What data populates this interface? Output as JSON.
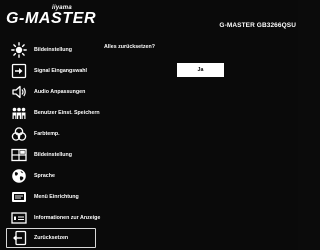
{
  "header": {
    "brand_small": "iiyama",
    "brand_main": "G-MASTER",
    "model": "G-MASTER GB3266QSU"
  },
  "sidebar": {
    "items": [
      {
        "label": "Bildeinstellung",
        "icon": "brightness-icon"
      },
      {
        "label": "Signal Eingangswahl",
        "icon": "input-select-icon"
      },
      {
        "label": "Audio Anpassungen",
        "icon": "speaker-icon"
      },
      {
        "label": "Benutzer Einst. Speichern",
        "icon": "users-icon"
      },
      {
        "label": "Farbtemp.",
        "icon": "color-temperature-icon"
      },
      {
        "label": "Bildeinstellung",
        "icon": "picture-adjust-icon"
      },
      {
        "label": "Sprache",
        "icon": "globe-icon"
      },
      {
        "label": "Menü Einrichtung",
        "icon": "menu-setup-icon"
      },
      {
        "label": "Informationen zur Anzeige",
        "icon": "display-info-icon"
      },
      {
        "label": "Zurücksetzen",
        "icon": "reset-icon"
      }
    ],
    "selected_index": 9
  },
  "dialog": {
    "prompt": "Alles zurücksetzen?",
    "yes_label": "Ja"
  },
  "colors": {
    "background": "#0a0a0a",
    "text": "#ffffff",
    "button_bg": "#ffffff",
    "button_text": "#000000",
    "selection_border": "#d8d8d8"
  }
}
